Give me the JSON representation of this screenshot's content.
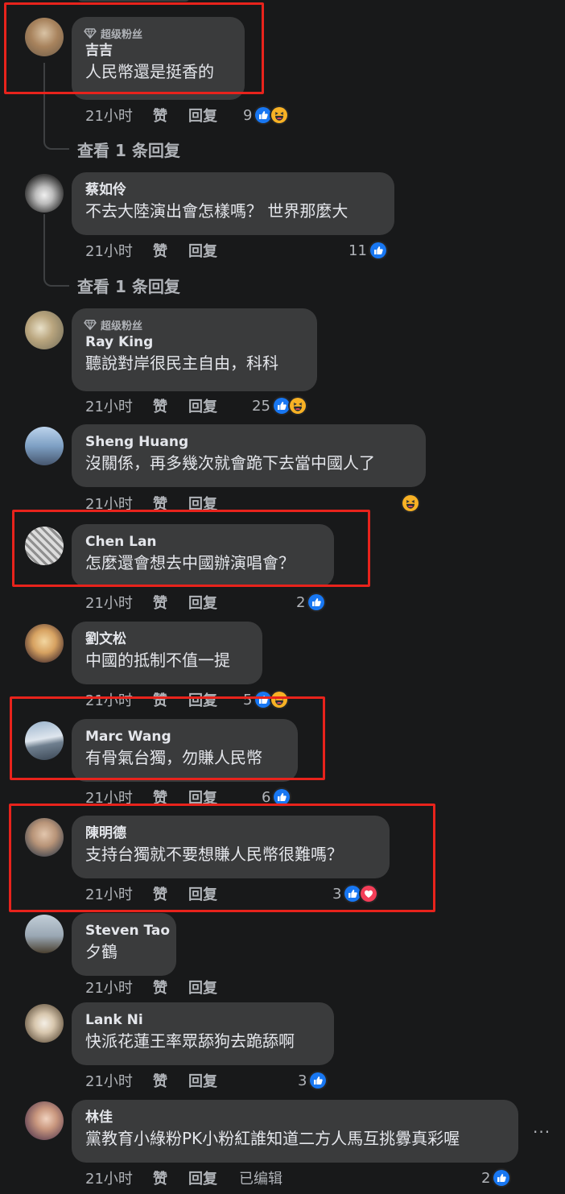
{
  "colors": {
    "background": "#18191a",
    "bubble": "#3a3b3c",
    "like_blue": "#1877f2",
    "love_red": "#f33e58",
    "highlight": "#e8231c"
  },
  "labels": {
    "super_fan": "超级粉丝",
    "like": "赞",
    "reply": "回复",
    "edited": "已编辑"
  },
  "comments": [
    {
      "name": "吉吉",
      "text": "人民幣還是挺香的",
      "time": "21小时",
      "reactions": "9",
      "fan": true
    },
    {
      "view_replies": "查看 1 条回复"
    },
    {
      "name": "蔡如伶",
      "text": "不去大陸演出會怎樣嗎？ 世界那麼大",
      "time": "21小时",
      "reactions": "11"
    },
    {
      "view_replies": "查看 1 条回复"
    },
    {
      "name": "Ray King",
      "text": "聽說對岸很民主自由，科科",
      "time": "21小时",
      "reactions": "25",
      "fan": true
    },
    {
      "name": "Sheng Huang",
      "text": "沒關係，再多幾次就會跪下去當中國人了",
      "time": "21小时",
      "reactions": ""
    },
    {
      "name": "Chen Lan",
      "text": "怎麼還會想去中國辦演唱會？",
      "time": "21小时",
      "reactions": "2"
    },
    {
      "name": "劉文松",
      "text": "中國的抵制不值一提",
      "time": "21小时",
      "reactions": "5"
    },
    {
      "name": "Marc Wang",
      "text": "有骨氣台獨，勿賺人民幣",
      "time": "21小时",
      "reactions": "6"
    },
    {
      "name": "陳明德",
      "text": "支持台獨就不要想賺人民幣很難嗎？",
      "time": "21小时",
      "reactions": "3"
    },
    {
      "name": "Steven Tao",
      "text": "夕鶴",
      "time": "21小时",
      "reactions": ""
    },
    {
      "name": "Lank Ni",
      "text": "快派花蓮王率眾舔狗去跪舔啊",
      "time": "21小时",
      "reactions": "3"
    },
    {
      "name": "林佳",
      "text": "黨教育小綠粉PK小粉紅誰知道二方人馬互挑釁真彩喔",
      "time": "21小时",
      "reactions": "2",
      "more": "···"
    }
  ]
}
